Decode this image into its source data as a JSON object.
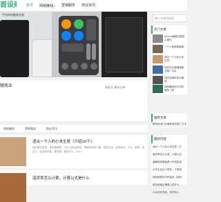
{
  "header": {
    "logo_text": "首设商",
    "nav": [
      {
        "label": "首页",
        "active": true,
        "has_arrow": false
      },
      {
        "label": "网络赚钱",
        "active": false,
        "has_arrow": true
      },
      {
        "label": "营销服务",
        "active": false,
        "has_arrow": false
      },
      {
        "label": "商业资讯",
        "active": false,
        "has_arrow": false
      }
    ],
    "search_placeholder": "输入关键词搜索..."
  },
  "hero": {
    "caption": "手机如何截屏长图"
  },
  "tag_block": {
    "title": "随商业",
    "sub": "随商业 最新文章"
  },
  "tabs": [
    "网络赚钱",
    "营销服务",
    "商业资讯"
  ],
  "articles": [
    {
      "title": "适合一个人的小本生意（介绍10个）",
      "excerpt": "现在做生意难，做些都算是，行业 已经没找到，快速找到的门路，现在生活，这种状况，下去，就是，我这个，创业的时候，都在想，做些什么，什么？"
    },
    {
      "title": "道货率怎么计算，计算公式是什么",
      "excerpt": ""
    }
  ],
  "sidebar": {
    "hot_title": "热门文章",
    "hot_items": [
      {
        "text": "iphone截屏长图怎么操作"
      },
      {
        "text": "一个人卖烤串能赚"
      },
      {
        "text": "适合一个人的小本生意"
      },
      {
        "text": "如何在抖音赚钱副业推广平台"
      },
      {
        "text": "钱庄自媒体怎么赚钱"
      },
      {
        "text": "网络赚钱的方法有哪些（附"
      }
    ],
    "recommend_title": "推荐文章",
    "recommend_text": "教育培训行业最有效的推广方法",
    "new_title": "最新内容",
    "new_items": [
      "适合一个人的小本生意（介",
      "道货率怎么计算，计算公式",
      "蓝朝现品服装是人在线批发",
      "大学生创业小项目，下单就",
      "保险销售技巧和话术（保险",
      "首页经营店铺收入的什么",
      "小众创业项目，农村收入"
    ]
  },
  "colors": {
    "accent": "#2fb07c"
  }
}
